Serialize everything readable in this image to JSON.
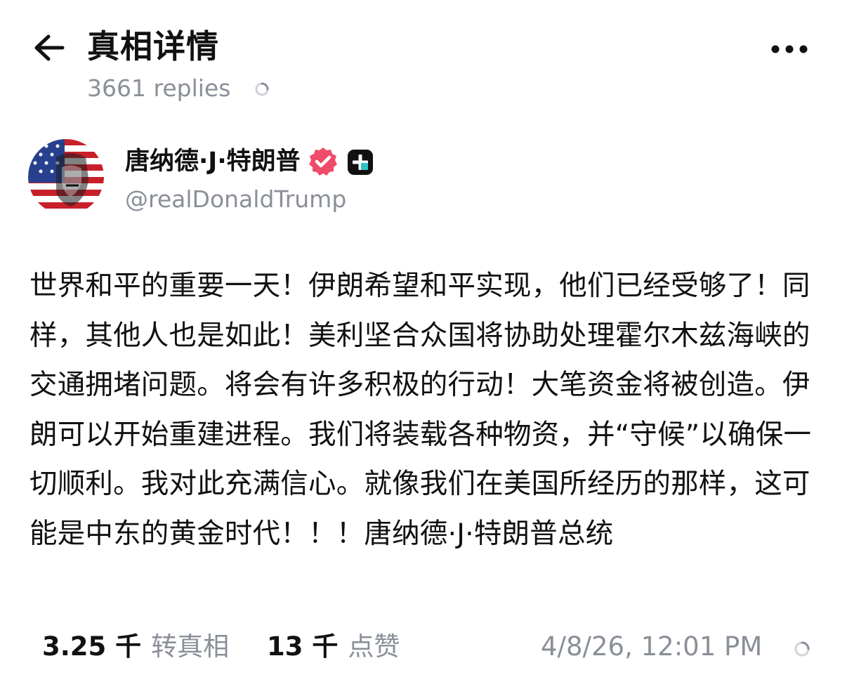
{
  "header": {
    "title": "真相详情",
    "reply_count": "3661 replies",
    "back_icon": "arrow-left-icon",
    "more_icon": "more-horizontal-icon"
  },
  "author": {
    "name": "唐纳德·J·特朗普",
    "handle": "@realDonaldTrump",
    "verified_icon": "verified-badge-icon",
    "verified_color": "#ef4b6b"
  },
  "post": {
    "text": "世界和平的重要一天！伊朗希望和平实现，他们已经受够了！同样，其他人也是如此！美利坚合众国将协助处理霍尔木兹海峡的交通拥堵问题。将会有许多积极的行动！大笔资金将被创造。伊朗可以开始重建进程。我们将装载各种物资，并“守候”以确保一切顺利。我对此充满信心。就像我们在美国所经历的那样，这可能是中东的黄金时代！！！唐纳德·J·特朗普总统"
  },
  "stats": {
    "retruths_count": "3.25 千",
    "retruths_label": "转真相",
    "likes_count": "13 千",
    "likes_label": "点赞",
    "timestamp": "4/8/26, 12:01 PM"
  },
  "colors": {
    "text_primary": "#111111",
    "text_secondary": "#8a8f98"
  }
}
